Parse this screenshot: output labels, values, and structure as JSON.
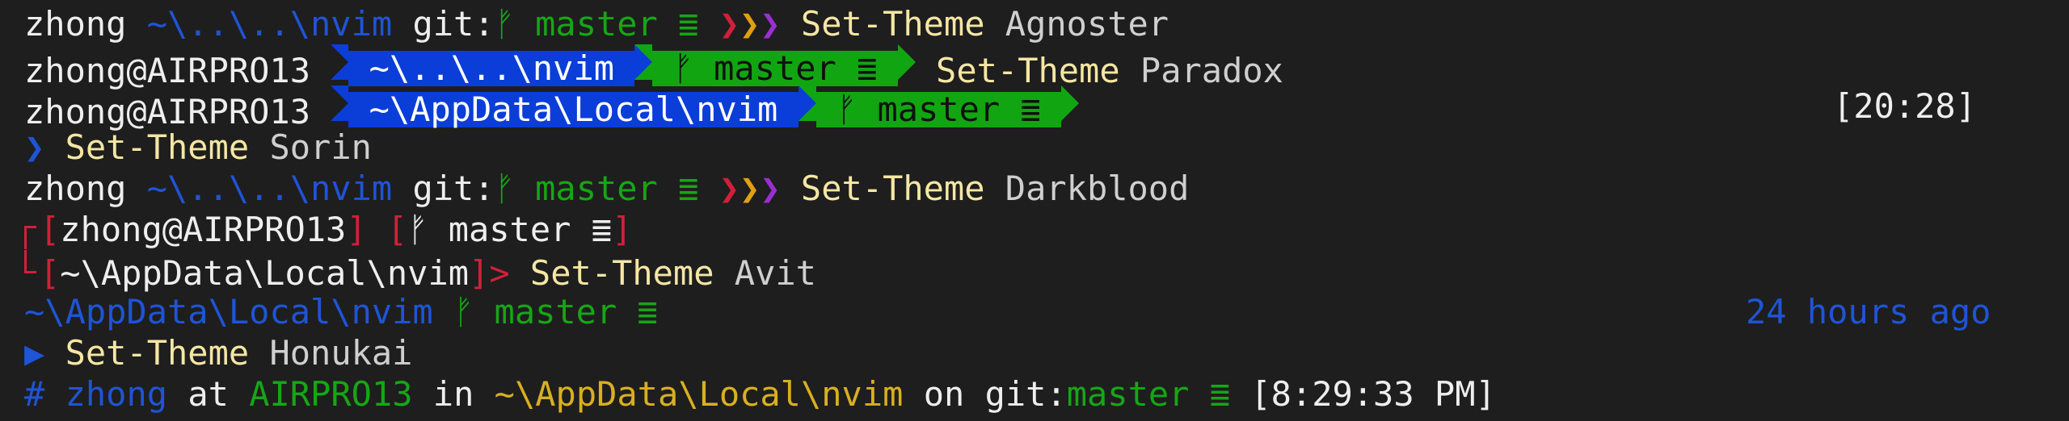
{
  "lines": {
    "agnoster": {
      "user": "zhong",
      "path": "~\\..\\..\\nvim",
      "git_label": "git:",
      "branch_icon": "ᚠ",
      "branch": "master",
      "status_icon": "≣",
      "prompt_chevrons": "❯❯❯",
      "command": "Set-Theme",
      "argument": "Agnoster"
    },
    "paradox": {
      "user_host": "zhong@AIRPRO13",
      "path": "~\\..\\..\\nvim",
      "branch_icon": "ᚠ",
      "branch": "master",
      "status_icon": "≣",
      "command": "Set-Theme",
      "argument": "Paradox"
    },
    "sorin_header": {
      "user_host": "zhong@AIRPRO13",
      "path": "~\\AppData\\Local\\nvim",
      "branch_icon": "ᚠ",
      "branch": "master",
      "status_icon": "≣",
      "time": "[20:28]"
    },
    "sorin": {
      "prompt": "❯",
      "command": "Set-Theme",
      "argument": "Sorin"
    },
    "darkblood_cmd": {
      "user": "zhong",
      "path": "~\\..\\..\\nvim",
      "git_label": "git:",
      "branch_icon": "ᚠ",
      "branch": "master",
      "status_icon": "≣",
      "prompt_chevrons": "❯❯❯",
      "command": "Set-Theme",
      "argument": "Darkblood"
    },
    "darkblood_top": {
      "open": "[",
      "user_host": "zhong@AIRPRO13",
      "close": "]",
      "branch_open": "[",
      "branch_icon": "ᚠ",
      "branch": "master",
      "status_icon": "≣",
      "branch_close": "]"
    },
    "darkblood_bottom": {
      "open": "[",
      "path": "~\\AppData\\Local\\nvim",
      "close": "]",
      "prompt": ">",
      "command": "Set-Theme",
      "argument": "Avit"
    },
    "avit_header": {
      "path": "~\\AppData\\Local\\nvim",
      "branch_icon": "ᚠ",
      "branch": "master",
      "status_icon": "≣",
      "time_ago": "24 hours ago"
    },
    "avit": {
      "prompt": "▶",
      "command": "Set-Theme",
      "argument": "Honukai"
    },
    "honukai": {
      "hash": "#",
      "user": "zhong",
      "at": "at",
      "host": "AIRPRO13",
      "in": "in",
      "path": "~\\AppData\\Local\\nvim",
      "on": "on",
      "git_label": "git:",
      "branch": "master",
      "status_icon": "≣",
      "time": "[8:29:33 PM]"
    }
  },
  "colors": {
    "background": "#1e1e1e",
    "blue": "#1f54d6",
    "green": "#16a616",
    "yellow": "#f5e6a3",
    "red": "#d0203a",
    "orange": "#e0a010",
    "purple": "#9a2fd0"
  }
}
